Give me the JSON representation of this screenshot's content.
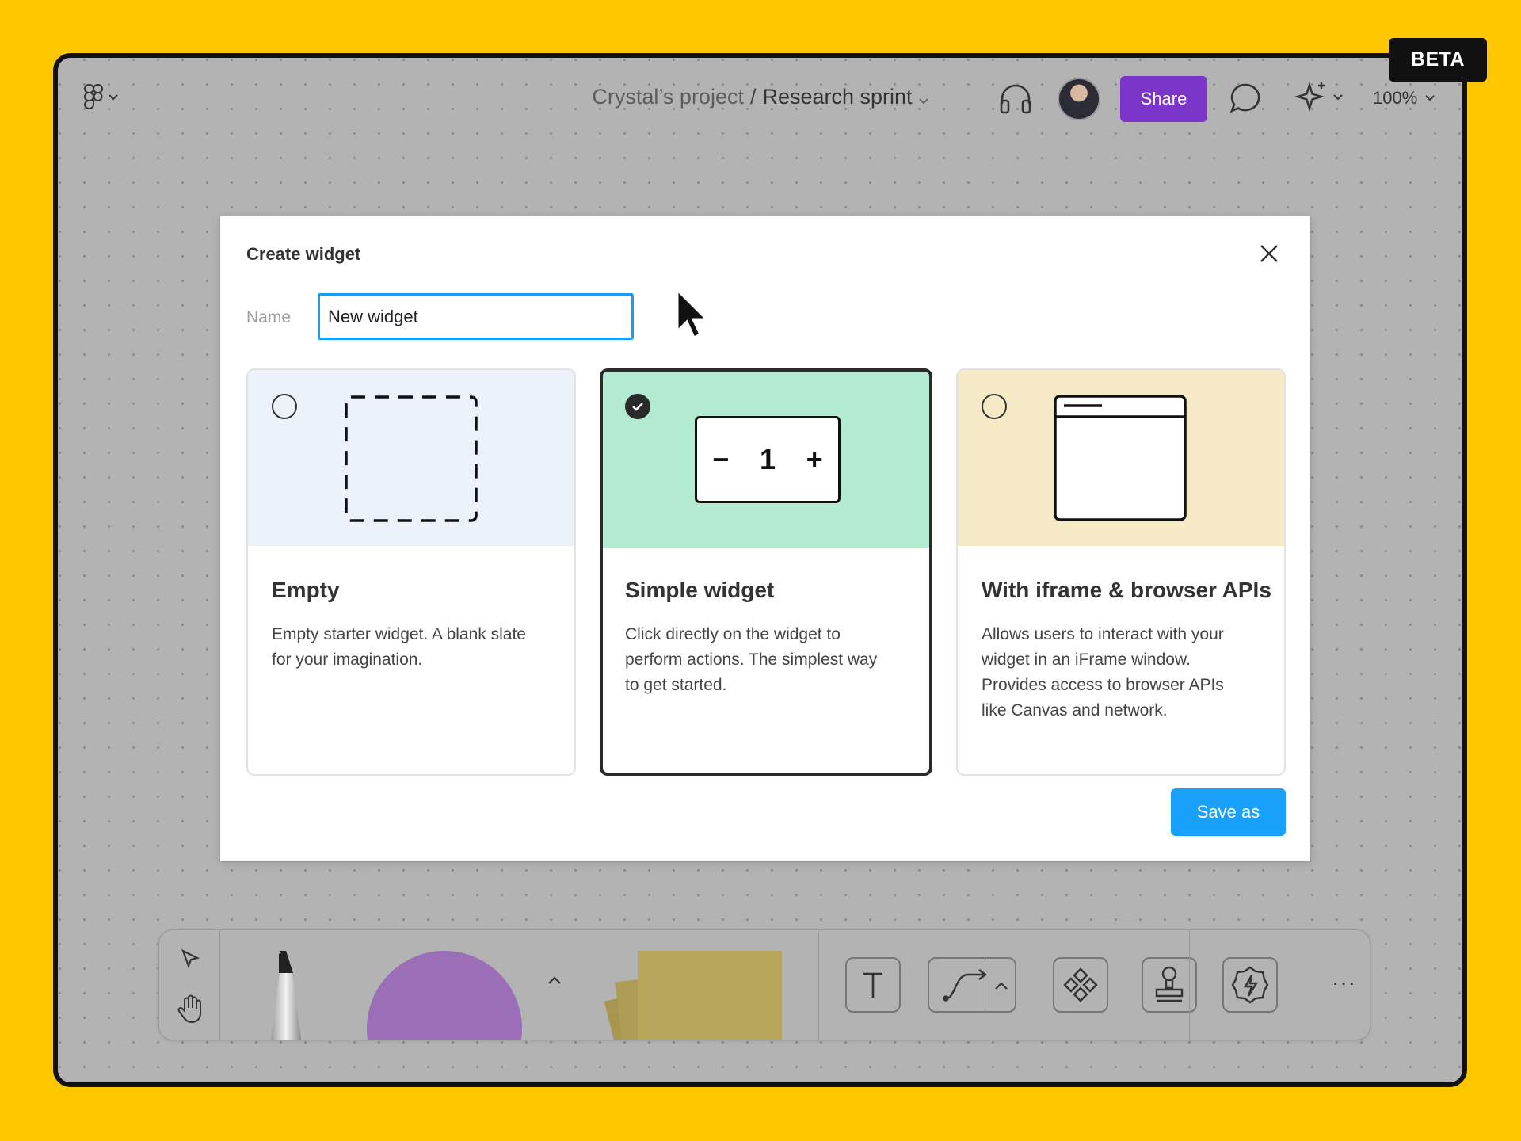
{
  "badge": {
    "label": "BETA"
  },
  "header": {
    "project": "Crystal’s project",
    "separator": "/",
    "file_name": "Research sprint",
    "share_label": "Share",
    "zoom": "100%"
  },
  "dialog": {
    "title": "Create widget",
    "name_label": "Name",
    "name_value": "New widget",
    "options": [
      {
        "title": "Empty",
        "description": "Empty starter widget. A blank slate for your imagination.",
        "selected": false,
        "bg": "#EBF2F9"
      },
      {
        "title": "Simple widget",
        "description": "Click directly on the widget to perform actions. The simplest way to get started.",
        "selected": true,
        "bg": "#B2EBD2",
        "counter": {
          "minus": "−",
          "value": "1",
          "plus": "+"
        }
      },
      {
        "title": "With iframe & browser APIs",
        "description": "Allows users to interact with your widget in an iFrame window. Provides access to browser APIs like Canvas and network.",
        "selected": false,
        "bg": "#F5E9C6"
      }
    ],
    "save_label": "Save as"
  },
  "toolbar": {
    "more_label": "···",
    "tools": [
      "move-tool",
      "hand-tool",
      "pencil-tool",
      "shape-tool",
      "sticky-note-tool",
      "text-tool",
      "connector-tool",
      "component-tool",
      "stamp-tool",
      "widget-tool"
    ]
  },
  "colors": {
    "background": "#FFC700",
    "share": "#7B35C8",
    "primary": "#18A0FB",
    "shape": "#9B6FB8",
    "sticky": "#B8A75A"
  }
}
